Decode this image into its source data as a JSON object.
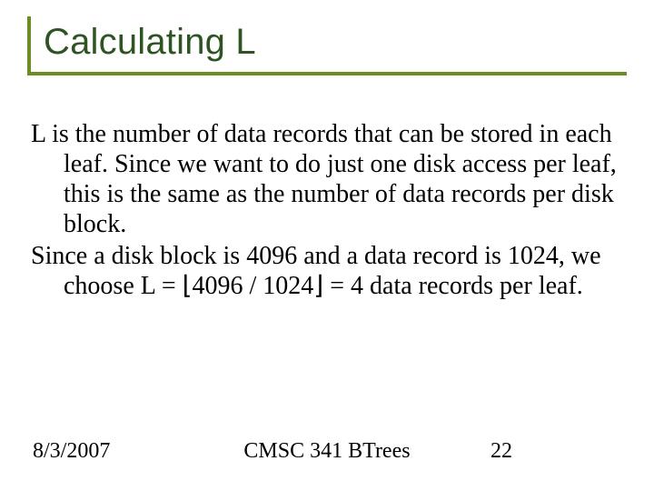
{
  "slide": {
    "title": "Calculating L",
    "paragraph1": "L is the number of data records that can be stored in each leaf.  Since we want to do just one disk access per leaf, this is the same as the number of data records per disk block.",
    "paragraph2": "Since a disk block is 4096 and a data record is 1024, we choose L = ⌊4096 / 1024⌋ = 4 data records per leaf."
  },
  "footer": {
    "date": "8/3/2007",
    "course": "CMSC 341 BTrees",
    "page": "22"
  }
}
